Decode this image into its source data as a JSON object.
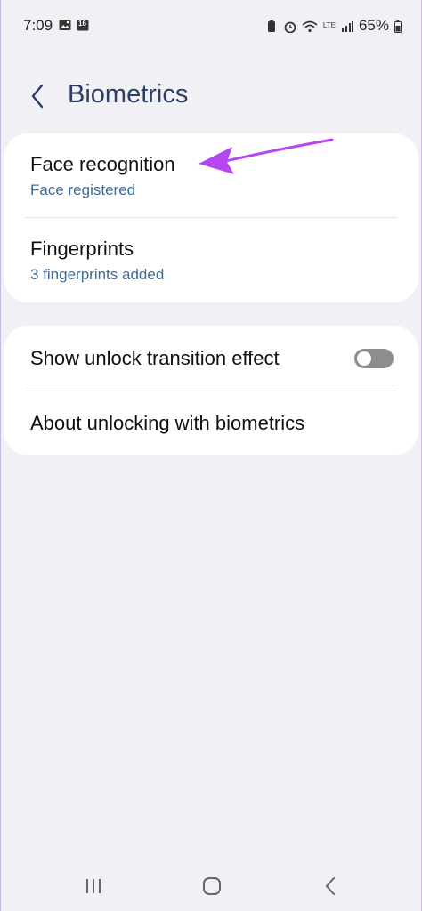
{
  "status": {
    "time": "7:09",
    "calendar_day": "16",
    "battery": "65%",
    "network": "LTE"
  },
  "header": {
    "title": "Biometrics"
  },
  "card1": {
    "face": {
      "title": "Face recognition",
      "subtitle": "Face registered"
    },
    "fingerprints": {
      "title": "Fingerprints",
      "subtitle": "3 fingerprints added"
    }
  },
  "card2": {
    "unlock_effect": {
      "title": "Show unlock transition effect",
      "toggle_on": false
    },
    "about": {
      "title": "About unlocking with biometrics"
    }
  },
  "colors": {
    "title": "#2c3e66",
    "subtitle": "#3e6b97",
    "arrow": "#b547f2",
    "toggle_off": "#8d8d8d"
  }
}
